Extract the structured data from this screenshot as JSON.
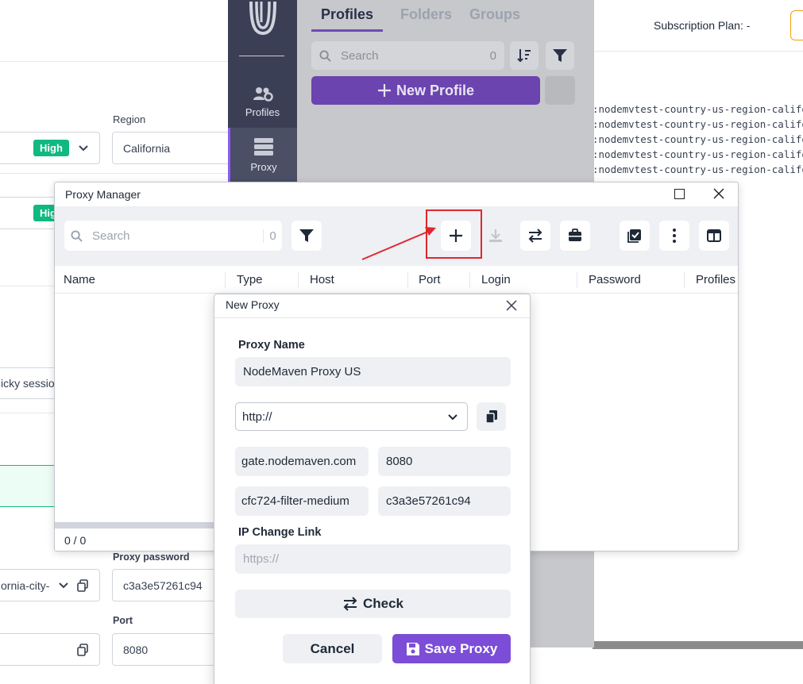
{
  "background": {
    "subscription_plan": "Subscription Plan: -",
    "region_label": "Region",
    "region_value": "California",
    "badge_1": "High",
    "badge_2": "High",
    "sticky_text": "icky sessio",
    "city_value": "ornia-city-",
    "proxy_password_label": "Proxy password",
    "proxy_password_value": "c3a3e57261c94",
    "port_label": "Port",
    "port_value": "8080",
    "log_lines": [
      ":nodemvtest-country-us-region-califor",
      ":nodemvtest-country-us-region-califor",
      ":nodemvtest-country-us-region-califor",
      ":nodemvtest-country-us-region-califor",
      ":nodemvtest-country-us-region-califor"
    ]
  },
  "app": {
    "sidebar": {
      "profiles_label": "Profiles",
      "proxy_label": "Proxy"
    },
    "tabs": [
      "Profiles",
      "Folders",
      "Groups"
    ],
    "search_placeholder": "Search",
    "search_count": "0",
    "new_profile_label": "New Profile"
  },
  "proxy_manager": {
    "title": "Proxy Manager",
    "search_placeholder": "Search",
    "search_count": "0",
    "columns": [
      "Name",
      "Type",
      "Host",
      "Port",
      "Login",
      "Password",
      "Profiles"
    ],
    "footer_count": "0 / 0",
    "accent_red": "#e0262f"
  },
  "new_proxy": {
    "title": "New Proxy",
    "proxy_name_label": "Proxy Name",
    "proxy_name_value": "NodeMaven Proxy US",
    "protocol": "http://",
    "host": "gate.nodemaven.com",
    "port": "8080",
    "login": "cfc724-filter-medium",
    "password": "c3a3e57261c94",
    "ip_change_label": "IP Change Link",
    "ip_change_placeholder": "https://",
    "check_label": "Check",
    "cancel_label": "Cancel",
    "save_label": "Save Proxy",
    "accent_purple": "#7c4dd6"
  }
}
